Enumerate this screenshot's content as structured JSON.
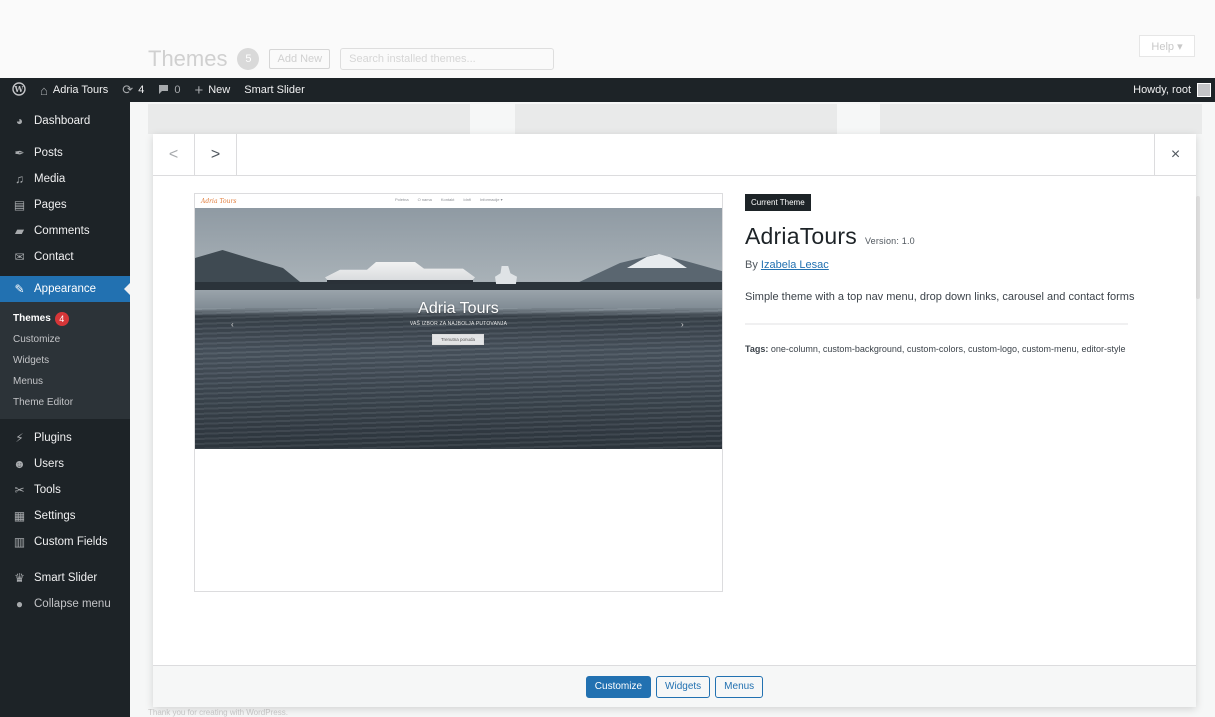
{
  "background": {
    "page_title": "Themes",
    "theme_count": "5",
    "add_new_label": "Add New",
    "search_placeholder": "Search installed themes...",
    "help_label": "Help ▾",
    "bottom_hint": "Thank you for creating with WordPress."
  },
  "adminbar": {
    "site_name": "Adria Tours",
    "updates_count": "4",
    "comments_count": "0",
    "new_label": "New",
    "smart_slider_label": "Smart Slider",
    "howdy_label": "Howdy, root"
  },
  "sidebar": {
    "items": [
      {
        "label": "Dashboard",
        "icon": "dashboard-icon"
      },
      {
        "label": "Posts",
        "icon": "pin-icon"
      },
      {
        "label": "Media",
        "icon": "media-icon"
      },
      {
        "label": "Pages",
        "icon": "pages-icon"
      },
      {
        "label": "Comments",
        "icon": "comment-icon"
      },
      {
        "label": "Contact",
        "icon": "mail-icon"
      },
      {
        "label": "Appearance",
        "icon": "brush-icon"
      },
      {
        "label": "Plugins",
        "icon": "plugin-icon"
      },
      {
        "label": "Users",
        "icon": "users-icon"
      },
      {
        "label": "Tools",
        "icon": "tools-icon"
      },
      {
        "label": "Settings",
        "icon": "settings-icon"
      },
      {
        "label": "Custom Fields",
        "icon": "fields-icon"
      },
      {
        "label": "Smart Slider",
        "icon": "slider-icon"
      },
      {
        "label": "Collapse menu",
        "icon": "collapse-icon"
      }
    ],
    "appearance_sub": {
      "themes": "Themes",
      "themes_badge": "4",
      "customize": "Customize",
      "widgets": "Widgets",
      "menus": "Menus",
      "theme_editor": "Theme Editor"
    }
  },
  "modal": {
    "prev_glyph": "<",
    "next_glyph": ">",
    "close_glyph": "×",
    "current_badge": "Current Theme",
    "theme_name": "AdriaTours",
    "version": "Version: 1.0",
    "author_prefix": "By",
    "author_name": "Izabela Lesac",
    "description": "Simple theme with a top nav menu, drop down links, carousel and contact forms",
    "tags_label": "Tags:",
    "tags": "one-column, custom-background, custom-colors, custom-logo, custom-menu, editor-style",
    "footer": {
      "customize": "Customize",
      "widgets": "Widgets",
      "menus": "Menus"
    },
    "screenshot": {
      "logo": "Adria Tours",
      "nav_links": [
        "Poletna",
        "O nama",
        "Kontakt",
        "Idnfi",
        "Informacije ▾"
      ],
      "hero_title": "Adria Tours",
      "hero_subtitle": "VAŠ IZBOR ZA NAJBOLJA PUTOVANJA",
      "hero_button": "Trenutna ponuda"
    }
  },
  "colors": {
    "accent": "#2271b1",
    "admin_dark": "#1d2327",
    "badge_red": "#d63638"
  }
}
